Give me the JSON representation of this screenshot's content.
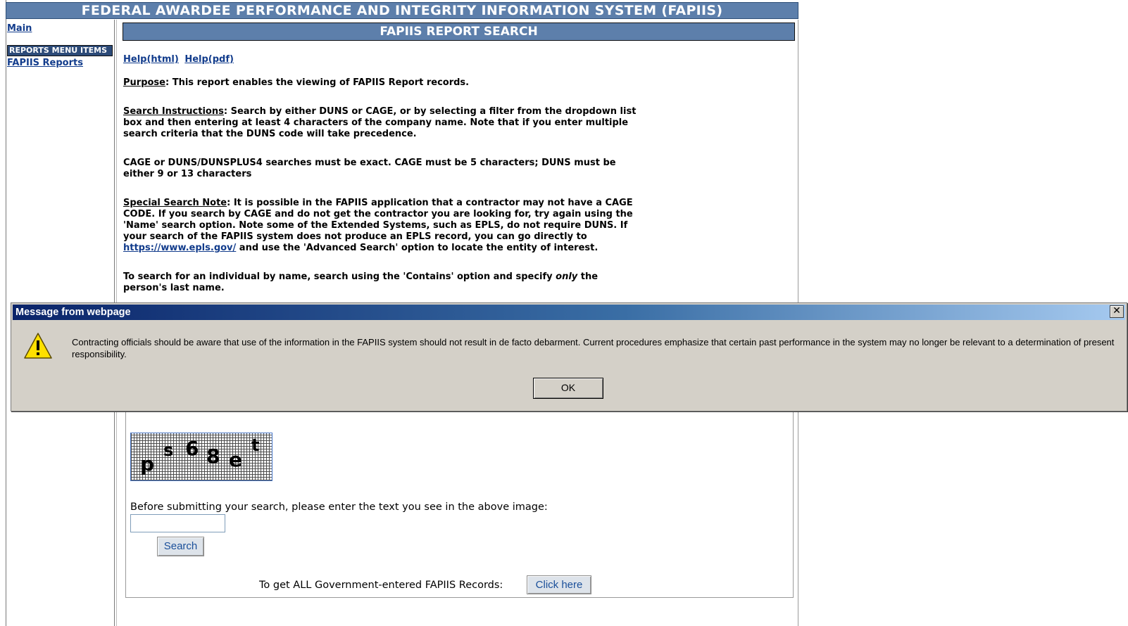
{
  "header": {
    "title": "FEDERAL AWARDEE PERFORMANCE AND INTEGRITY INFORMATION SYSTEM (FAPIIS)"
  },
  "sidebar": {
    "main_link": "Main",
    "menu_heading": "REPORTS MENU ITEMS",
    "reports_link": "FAPIIS Reports"
  },
  "main": {
    "title": "FAPIIS REPORT SEARCH",
    "help_html": "Help(html)",
    "help_pdf": "Help(pdf)",
    "purpose_label": "Purpose",
    "purpose_text": ": This report enables the viewing of FAPIIS Report records.",
    "instructions_label": "Search Instructions",
    "instructions_text": ": Search by either DUNS or CAGE, or by selecting a filter from the dropdown list box and then entering at least 4 characters of the company name. Note that if you enter multiple search criteria that the DUNS code will take precedence.",
    "cage_note": "CAGE or DUNS/DUNSPLUS4 searches must be exact. CAGE must be 5 characters; DUNS must be either 9 or 13 characters",
    "special_label": "Special Search Note",
    "special_text_1": ": It is possible in the FAPIIS application that a contractor may not have a CAGE CODE. If you search by CAGE and do not get the contractor you are looking for, try again using the 'Name' search option. Note some of the Extended Systems, such as EPLS, do not require DUNS. If your search of the FAPIIS system does not produce an EPLS record, you can go directly to ",
    "special_link": "https://www.epls.gov/",
    "special_text_2": " and use the 'Advanced Search' option to locate the entity of interest.",
    "individual_text_1": "To search for an individual by name, search using the 'Contains' option and specify ",
    "individual_em": "only",
    "individual_text_2": " the person's last name.",
    "captcha_chars": [
      "p",
      "s",
      "6",
      "8",
      "e",
      "t"
    ],
    "captcha_prompt": "Before submitting your search, please enter the text you see in the above image:",
    "captcha_value": "",
    "search_button": "Search",
    "all_records_label": "To get ALL Government-entered FAPIIS Records:",
    "click_here_button": "Click here"
  },
  "dialog": {
    "title": "Message from webpage",
    "close_glyph": "✕",
    "message": "Contracting officials should be aware that use of the information in the FAPIIS system should not result in de facto debarment.  Current procedures emphasize that certain past performance in the system may no longer be relevant to a determination of present responsibility.",
    "ok_button": "OK",
    "icon": "warning-icon"
  },
  "colors": {
    "header_blue": "#5d7fab",
    "menu_heading": "#2c4a78",
    "link": "#123c8c",
    "dialog_face": "#d4d0c8",
    "warning_yellow": "#ffe000"
  }
}
